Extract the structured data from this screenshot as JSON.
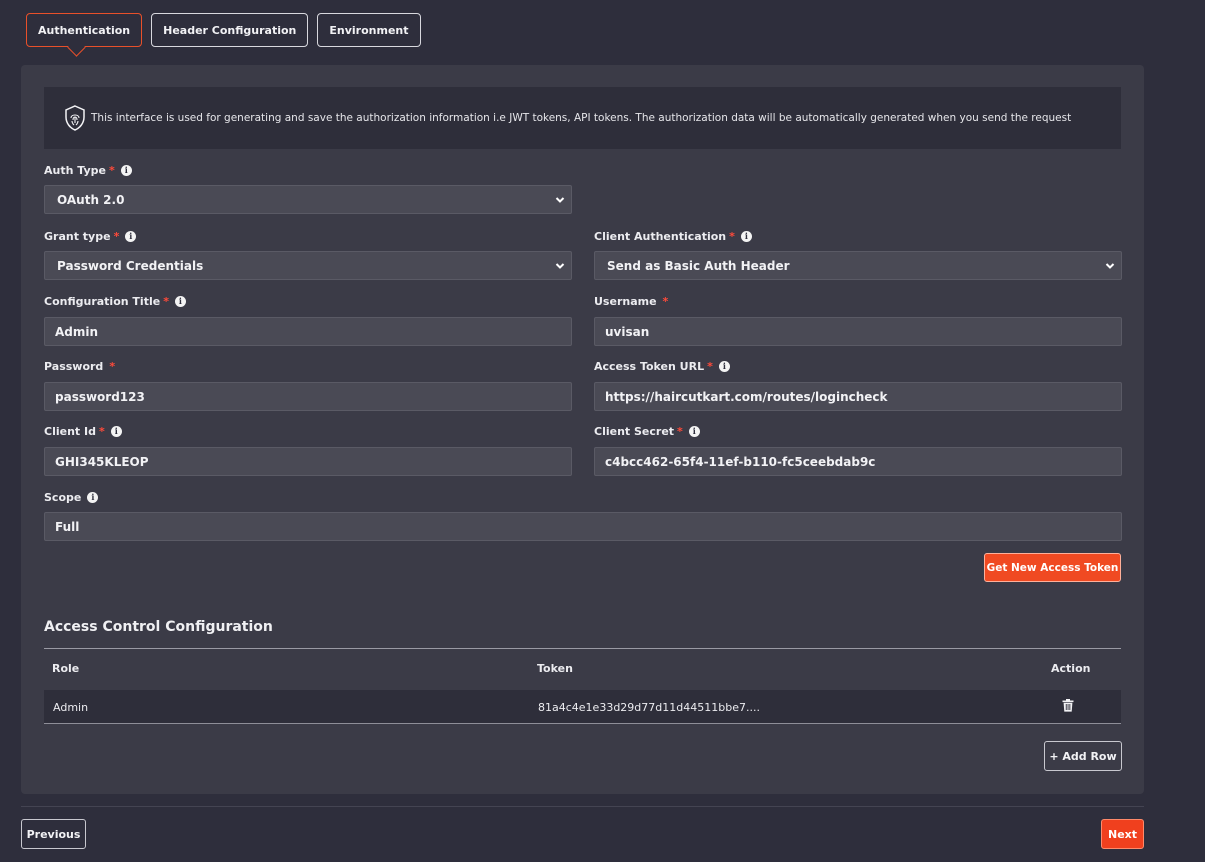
{
  "tabs": [
    {
      "label": "Authentication"
    },
    {
      "label": "Header Configuration"
    },
    {
      "label": "Environment"
    }
  ],
  "info_text": "This interface is used for generating and save the authorization information i.e JWT tokens, API tokens. The authorization data will be automatically generated when you send the request",
  "form": {
    "auth_type": {
      "label": "Auth Type",
      "value": "OAuth 2.0"
    },
    "grant_type": {
      "label": "Grant type",
      "value": "Password Credentials"
    },
    "client_auth": {
      "label": "Client Authentication",
      "value": "Send as Basic Auth Header"
    },
    "config_title": {
      "label": "Configuration Title",
      "value": "Admin"
    },
    "username": {
      "label": "Username",
      "value": "uvisan"
    },
    "password": {
      "label": "Password",
      "value": "password123"
    },
    "access_token_url": {
      "label": "Access Token URL",
      "value": "https://haircutkart.com/routes/logincheck"
    },
    "client_id": {
      "label": "Client Id",
      "value": "GHI345KLEOP"
    },
    "client_secret": {
      "label": "Client Secret",
      "value": "c4bcc462-65f4-11ef-b110-fc5ceebdab9c"
    },
    "scope": {
      "label": "Scope",
      "value": "Full"
    },
    "required_mark": "*",
    "info_glyph": "i"
  },
  "get_token_label": "Get New Access Token",
  "access_control": {
    "title": "Access Control Configuration",
    "columns": [
      "Role",
      "Token",
      "Action"
    ],
    "rows": [
      {
        "role": "Admin",
        "token": "81a4c4e1e33d29d77d11d44511bbe7...."
      }
    ],
    "add_row_label": "+ Add Row"
  },
  "nav": {
    "previous": "Previous",
    "next": "Next"
  },
  "colors": {
    "accent": "#f04a22",
    "panel": "#3b3b47",
    "background": "#2e2e3c"
  },
  "icons": {
    "info_banner": "shield-fingerprint-icon",
    "delete": "trash-icon",
    "dropdown": "chevron-down-icon"
  }
}
